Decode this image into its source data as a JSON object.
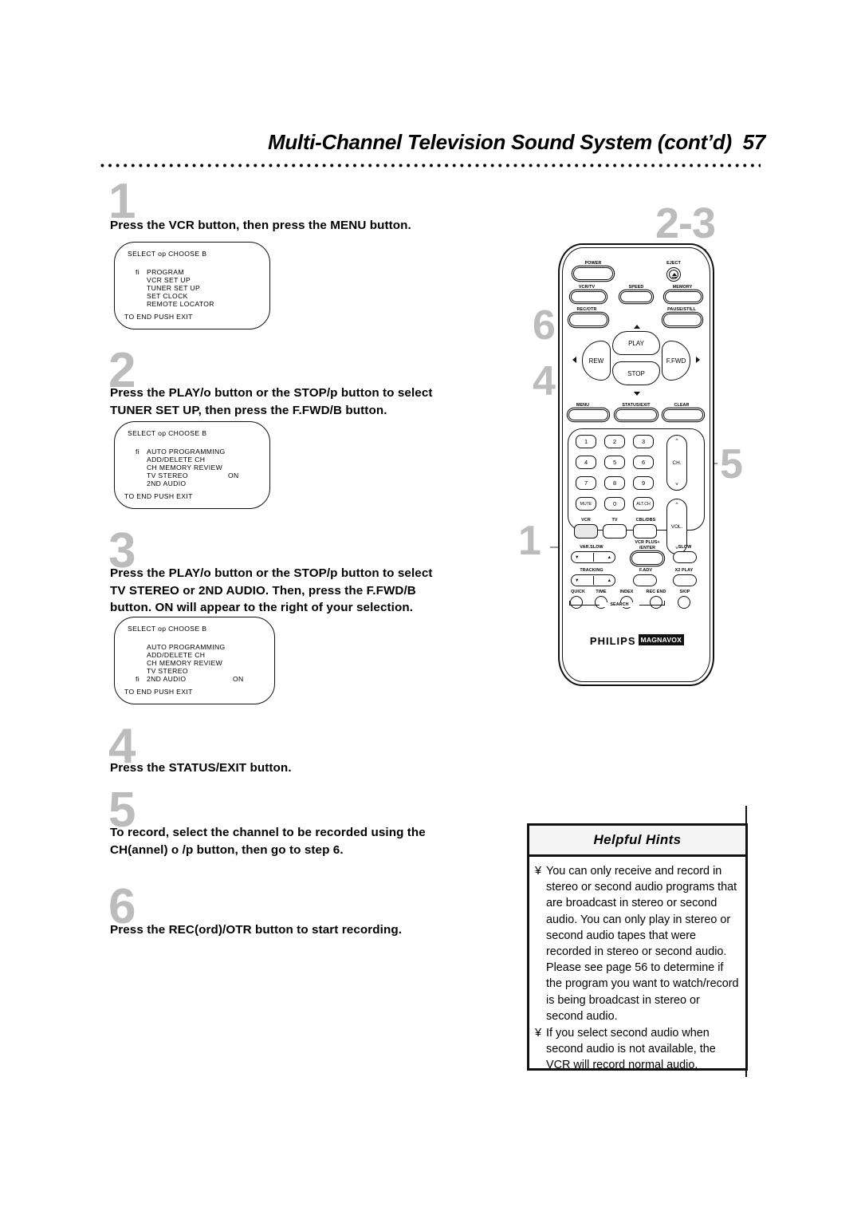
{
  "header": {
    "title": "Multi-Channel Television Sound System (cont’d)",
    "page_number": "57"
  },
  "steps": [
    {
      "number": "1",
      "text_lines": [
        "Press the VCR button, then press the MENU button."
      ]
    },
    {
      "number": "2",
      "text_lines": [
        "Press the PLAY/o  button or the STOP/p  button to select",
        "TUNER SET UP, then press the F.FWD/B  button."
      ]
    },
    {
      "number": "3",
      "text_lines": [
        "Press the PLAY/o  button or the STOP/p  button to select",
        "TV STEREO or 2ND AUDIO. Then, press the F.FWD/B",
        "button. ON will appear to the right of your selection."
      ]
    },
    {
      "number": "4",
      "text_lines": [
        "Press the STATUS/EXIT button."
      ]
    },
    {
      "number": "5",
      "text_lines": [
        "To record, select the channel to be recorded using the",
        "CH(annel) o /p  button, then go to step 6."
      ]
    },
    {
      "number": "6",
      "text_lines": [
        "Press the REC(ord)/OTR button to start recording."
      ]
    }
  ],
  "osd_screens": [
    {
      "top_line": "SELECT op   CHOOSE B",
      "items": [
        {
          "marker": "fi",
          "label": "PROGRAM",
          "value": ""
        },
        {
          "marker": "",
          "label": "VCR SET UP",
          "value": ""
        },
        {
          "marker": "",
          "label": "TUNER SET UP",
          "value": ""
        },
        {
          "marker": "",
          "label": "SET CLOCK",
          "value": ""
        },
        {
          "marker": "",
          "label": "REMOTE LOCATOR",
          "value": ""
        }
      ],
      "footer": "TO END PUSH EXIT"
    },
    {
      "top_line": "SELECT op   CHOOSE B",
      "items": [
        {
          "marker": "fi",
          "label": "AUTO PROGRAMMING",
          "value": ""
        },
        {
          "marker": "",
          "label": "ADD/DELETE CH",
          "value": ""
        },
        {
          "marker": "",
          "label": "CH MEMORY REVIEW",
          "value": ""
        },
        {
          "marker": "",
          "label": "TV STEREO",
          "value": "ON"
        },
        {
          "marker": "",
          "label": "2ND AUDIO",
          "value": ""
        }
      ],
      "footer": "TO END PUSH EXIT"
    },
    {
      "top_line": "SELECT op   CHOOSE B",
      "items": [
        {
          "marker": "",
          "label": "AUTO PROGRAMMING",
          "value": ""
        },
        {
          "marker": "",
          "label": "ADD/DELETE CH",
          "value": ""
        },
        {
          "marker": "",
          "label": "CH MEMORY REVIEW",
          "value": ""
        },
        {
          "marker": "",
          "label": "TV STEREO",
          "value": ""
        },
        {
          "marker": "fi",
          "label": "2ND AUDIO",
          "value": "ON"
        }
      ],
      "footer": "TO END PUSH EXIT"
    }
  ],
  "callouts": [
    {
      "id": "callout-2-3",
      "label": "2-3"
    },
    {
      "id": "callout-6",
      "label": "6"
    },
    {
      "id": "callout-4",
      "label": "4"
    },
    {
      "id": "callout-5",
      "label": "5"
    },
    {
      "id": "callout-1",
      "label": "1"
    }
  ],
  "remote": {
    "brand_primary": "PHILIPS",
    "brand_secondary": "MAGNAVOX",
    "buttons": {
      "power": "POWER",
      "eject": "EJECT",
      "vcr_tv": "VCR/TV",
      "speed": "SPEED",
      "memory": "MEMORY",
      "rec_otr": "REC/OTR",
      "pause_still": "PAUSE/STILL",
      "play": "PLAY",
      "rew": "REW",
      "ffwd": "F.FWD",
      "stop": "STOP",
      "menu": "MENU",
      "status_exit": "STATUS/EXIT",
      "clear": "CLEAR",
      "mute": "MUTE",
      "alt_ch": "ALT.CH",
      "vcr": "VCR",
      "tv": "TV",
      "cbl_dbs": "CBL/DBS",
      "ch": "CH.",
      "vol": "VOL.",
      "var_slow": "VAR.SLOW",
      "vcr_plus_enter_l1": "VCR PLUS+",
      "vcr_plus_enter_l2": "/ENTER",
      "slow": "SLOW",
      "tracking": "TRACKING",
      "f_adv": "F.ADV",
      "x2_play": "X2 PLAY",
      "quick": "QUICK",
      "time": "TIME",
      "index": "INDEX",
      "rec_end": "REC END",
      "skip": "SKIP",
      "search": "SEARCH"
    },
    "keypad": [
      "1",
      "2",
      "3",
      "4",
      "5",
      "6",
      "7",
      "8",
      "9",
      "0"
    ]
  },
  "hints": {
    "title": "Helpful Hints",
    "bullet": "¥",
    "items": [
      "You can only receive and record in stereo or second audio programs that are broadcast in stereo or second audio. You can only play in stereo or second audio tapes that were recorded in stereo or second audio.  Please see page 56 to determine if the program you want to watch/record is being broadcast in stereo or second audio.",
      "If you select second audio when second audio is not available, the VCR will record normal audio."
    ]
  }
}
